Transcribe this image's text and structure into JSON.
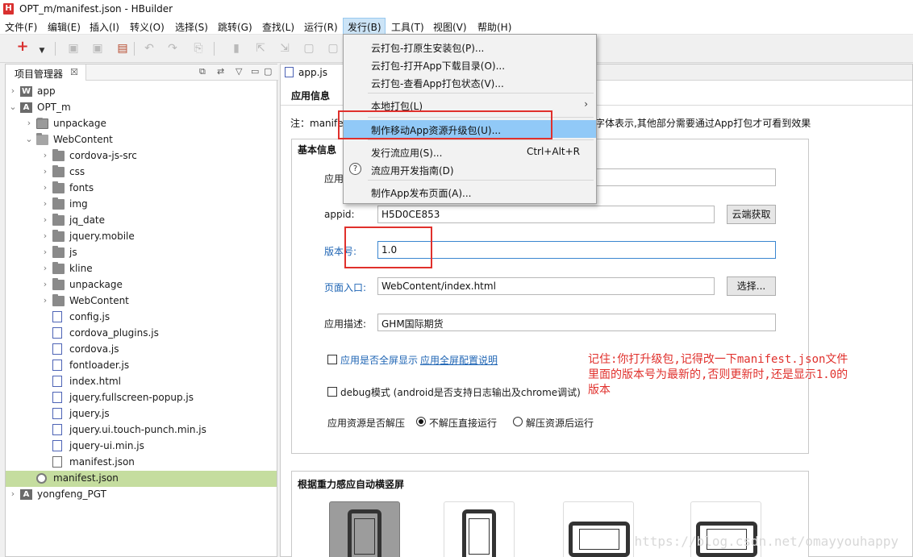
{
  "window": {
    "logo": "H",
    "title": "OPT_m/manifest.json  -  HBuilder"
  },
  "menubar": [
    "文件(F)",
    "编辑(E)",
    "插入(I)",
    "转义(O)",
    "选择(S)",
    "跳转(G)",
    "查找(L)",
    "运行(R)",
    "发行(B)",
    "工具(T)",
    "视图(V)",
    "帮助(H)"
  ],
  "toolbar": {
    "new_icon": "plus-icon",
    "new_glyph": "+"
  },
  "project_panel": {
    "title": "项目管理器",
    "close": "☒",
    "tree": [
      {
        "label": "app",
        "icon": "project-w-icon",
        "level": 0,
        "twisty": "›",
        "icon_text": "W"
      },
      {
        "label": "OPT_m",
        "icon": "project-a-icon",
        "level": 0,
        "twisty": "⌄",
        "icon_text": "A"
      },
      {
        "label": "unpackage",
        "icon": "package-folder-icon",
        "level": 1,
        "twisty": "›"
      },
      {
        "label": "WebContent",
        "icon": "folder-open-icon",
        "level": 1,
        "twisty": "⌄"
      },
      {
        "label": "cordova-js-src",
        "icon": "folder-icon",
        "level": 2,
        "twisty": "›"
      },
      {
        "label": "css",
        "icon": "folder-icon",
        "level": 2,
        "twisty": "›"
      },
      {
        "label": "fonts",
        "icon": "folder-icon",
        "level": 2,
        "twisty": "›"
      },
      {
        "label": "img",
        "icon": "folder-icon",
        "level": 2,
        "twisty": "›"
      },
      {
        "label": "jq_date",
        "icon": "folder-icon",
        "level": 2,
        "twisty": "›"
      },
      {
        "label": "jquery.mobile",
        "icon": "folder-icon",
        "level": 2,
        "twisty": "›"
      },
      {
        "label": "js",
        "icon": "folder-icon",
        "level": 2,
        "twisty": "›"
      },
      {
        "label": "kline",
        "icon": "folder-icon",
        "level": 2,
        "twisty": "›"
      },
      {
        "label": "unpackage",
        "icon": "folder-icon",
        "level": 2,
        "twisty": "›"
      },
      {
        "label": "WebContent",
        "icon": "folder-icon",
        "level": 2,
        "twisty": "›"
      },
      {
        "label": "config.js",
        "icon": "js-file-icon",
        "level": 2
      },
      {
        "label": "cordova_plugins.js",
        "icon": "js-file-icon",
        "level": 2
      },
      {
        "label": "cordova.js",
        "icon": "js-file-icon",
        "level": 2
      },
      {
        "label": "fontloader.js",
        "icon": "js-file-icon",
        "level": 2
      },
      {
        "label": "index.html",
        "icon": "html-file-icon",
        "level": 2
      },
      {
        "label": "jquery.fullscreen-popup.js",
        "icon": "js-file-icon",
        "level": 2
      },
      {
        "label": "jquery.js",
        "icon": "js-file-icon",
        "level": 2
      },
      {
        "label": "jquery.ui.touch-punch.min.js",
        "icon": "js-file-icon",
        "level": 2
      },
      {
        "label": "jquery-ui.min.js",
        "icon": "js-file-icon",
        "level": 2
      },
      {
        "label": "manifest.json",
        "icon": "json-file-icon",
        "level": 2
      },
      {
        "label": "manifest.json",
        "icon": "manifest-gear-icon",
        "level": 1,
        "selected": true
      },
      {
        "label": "yongfeng_PGT",
        "icon": "project-a-icon",
        "level": 0,
        "twisty": "›",
        "icon_text": "A"
      }
    ]
  },
  "editor": {
    "tab_label": "app.js",
    "section_header": "应用信息",
    "note_left": "注：manife",
    "note_right": "字体表示,其他部分需要通过App打包才可看到效果",
    "basic_group_title": "基本信息",
    "fields": {
      "app_name_label": "应用",
      "app_name_value": "",
      "appid_label": "appid:",
      "appid_value": "H5D0CE853",
      "appid_button": "云端获取",
      "version_label": "版本号:",
      "version_value": "1.0",
      "entry_label": "页面入口:",
      "entry_value": "WebContent/index.html",
      "entry_button": "选择...",
      "desc_label": "应用描述:",
      "desc_value": "GHM国际期货"
    },
    "fullscreen_label": "应用是否全屏显示",
    "fullscreen_link": "应用全屏配置说明",
    "debug_label": "debug模式 (android是否支持日志输出及chrome调试)",
    "unpack_label": "应用资源是否解压",
    "unpack_options": [
      "不解压直接运行",
      "解压资源后运行"
    ],
    "unpack_selected": 0,
    "orient_group_title": "根据重力感应自动横竖屏",
    "orient_selected": 0
  },
  "annotation": {
    "text": "记住:你打升级包,记得改一下manifest.json文件里面的版本号为最新的,否则更新时,还是显示1.0的版本",
    "color": "#e0302c"
  },
  "dropdown": {
    "items": [
      {
        "label": "云打包-打原生安装包(P)..."
      },
      {
        "label": "云打包-打开App下载目录(O)..."
      },
      {
        "label": "云打包-查看App打包状态(V)..."
      },
      {
        "label": "本地打包(L)",
        "submenu": true
      },
      {
        "label": "制作移动App资源升级包(U)...",
        "highlighted": true
      },
      {
        "label": "发行流应用(S)...",
        "accel": "Ctrl+Alt+R"
      },
      {
        "label": "流应用开发指南(D)",
        "icon": "help-icon"
      },
      {
        "label": "制作App发布页面(A)..."
      }
    ],
    "help_glyph": "?",
    "submenu_glyph": "›"
  },
  "watermark": "https://blog.csdn.net/omayyouhappy"
}
